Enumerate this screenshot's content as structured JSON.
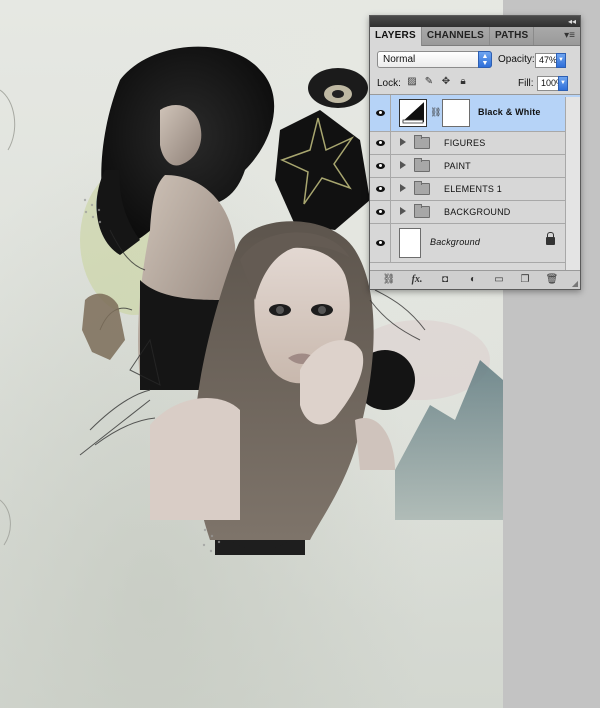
{
  "panel": {
    "tabs": [
      {
        "label": "LAYERS",
        "active": true
      },
      {
        "label": "CHANNELS",
        "active": false
      },
      {
        "label": "PATHS",
        "active": false
      }
    ],
    "blend_mode": "Normal",
    "opacity_label": "Opacity:",
    "opacity_value": "47%",
    "lock_label": "Lock:",
    "fill_label": "Fill:",
    "fill_value": "100%",
    "layers": [
      {
        "name": "Black & White",
        "type": "adjustment",
        "selected": true,
        "visible": true
      },
      {
        "name": "FIGURES",
        "type": "group",
        "visible": true
      },
      {
        "name": "PAINT",
        "type": "group",
        "visible": true
      },
      {
        "name": "ELEMENTS 1",
        "type": "group",
        "visible": true
      },
      {
        "name": "BACKGROUND",
        "type": "group",
        "visible": true
      },
      {
        "name": "Background",
        "type": "background",
        "locked": true,
        "visible": true
      }
    ],
    "footer_icons": [
      "link-layers-icon",
      "fx-icon",
      "add-mask-icon",
      "adjustment-layer-icon",
      "new-group-icon",
      "new-layer-icon",
      "trash-icon"
    ]
  },
  "colors": {
    "selection": "#b6d3f7",
    "panel_bg": "#d8d8d8",
    "accent_blue": "#2f6fd9",
    "workspace": "#c4c4c4"
  }
}
